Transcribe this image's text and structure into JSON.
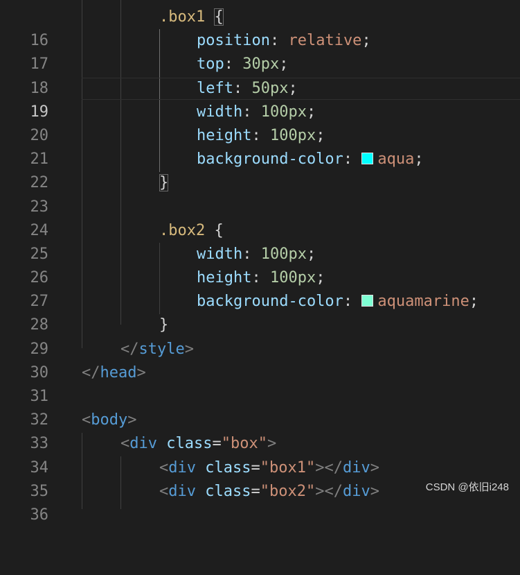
{
  "editor": {
    "theme_colors": {
      "background": "#1e1e1e",
      "line_number": "#858585",
      "selector": "#d7ba7d",
      "property": "#9cdcfe",
      "value": "#ce9178",
      "number": "#b5cea8",
      "tag": "#569cd6",
      "angle_bracket": "#808080"
    },
    "current_line": "19",
    "lines": [
      {
        "num": "16",
        "selector": ".box1",
        "brace": "{"
      },
      {
        "num": "17",
        "prop": "position",
        "val": "relative"
      },
      {
        "num": "18",
        "prop": "top",
        "val": "30px"
      },
      {
        "num": "19",
        "prop": "left",
        "val": "50px"
      },
      {
        "num": "20",
        "prop": "width",
        "val": "100px"
      },
      {
        "num": "21",
        "prop": "height",
        "val": "100px"
      },
      {
        "num": "22",
        "prop": "background-color",
        "val": "aqua",
        "swatch": "#00ffff"
      },
      {
        "num": "23",
        "brace": "}"
      },
      {
        "num": "24"
      },
      {
        "num": "25",
        "selector": ".box2",
        "brace": "{"
      },
      {
        "num": "26",
        "prop": "width",
        "val": "100px"
      },
      {
        "num": "27",
        "prop": "height",
        "val": "100px"
      },
      {
        "num": "28",
        "prop": "background-color",
        "val": "aquamarine",
        "swatch": "#7fffd4"
      },
      {
        "num": "29",
        "brace": "}"
      },
      {
        "num": "30",
        "tag_close": "style"
      },
      {
        "num": "31",
        "tag_close": "head"
      },
      {
        "num": "32"
      },
      {
        "num": "33",
        "tag_open": "body"
      },
      {
        "num": "34",
        "tag": "div",
        "attr": "class",
        "attr_val": "\"box\""
      },
      {
        "num": "35",
        "tag": "div",
        "attr": "class",
        "attr_val": "\"box1\"",
        "close": "div"
      },
      {
        "num": "36",
        "tag": "div",
        "attr": "class",
        "attr_val": "\"box2\"",
        "close": "div"
      }
    ]
  },
  "watermark": "CSDN @依旧i248"
}
